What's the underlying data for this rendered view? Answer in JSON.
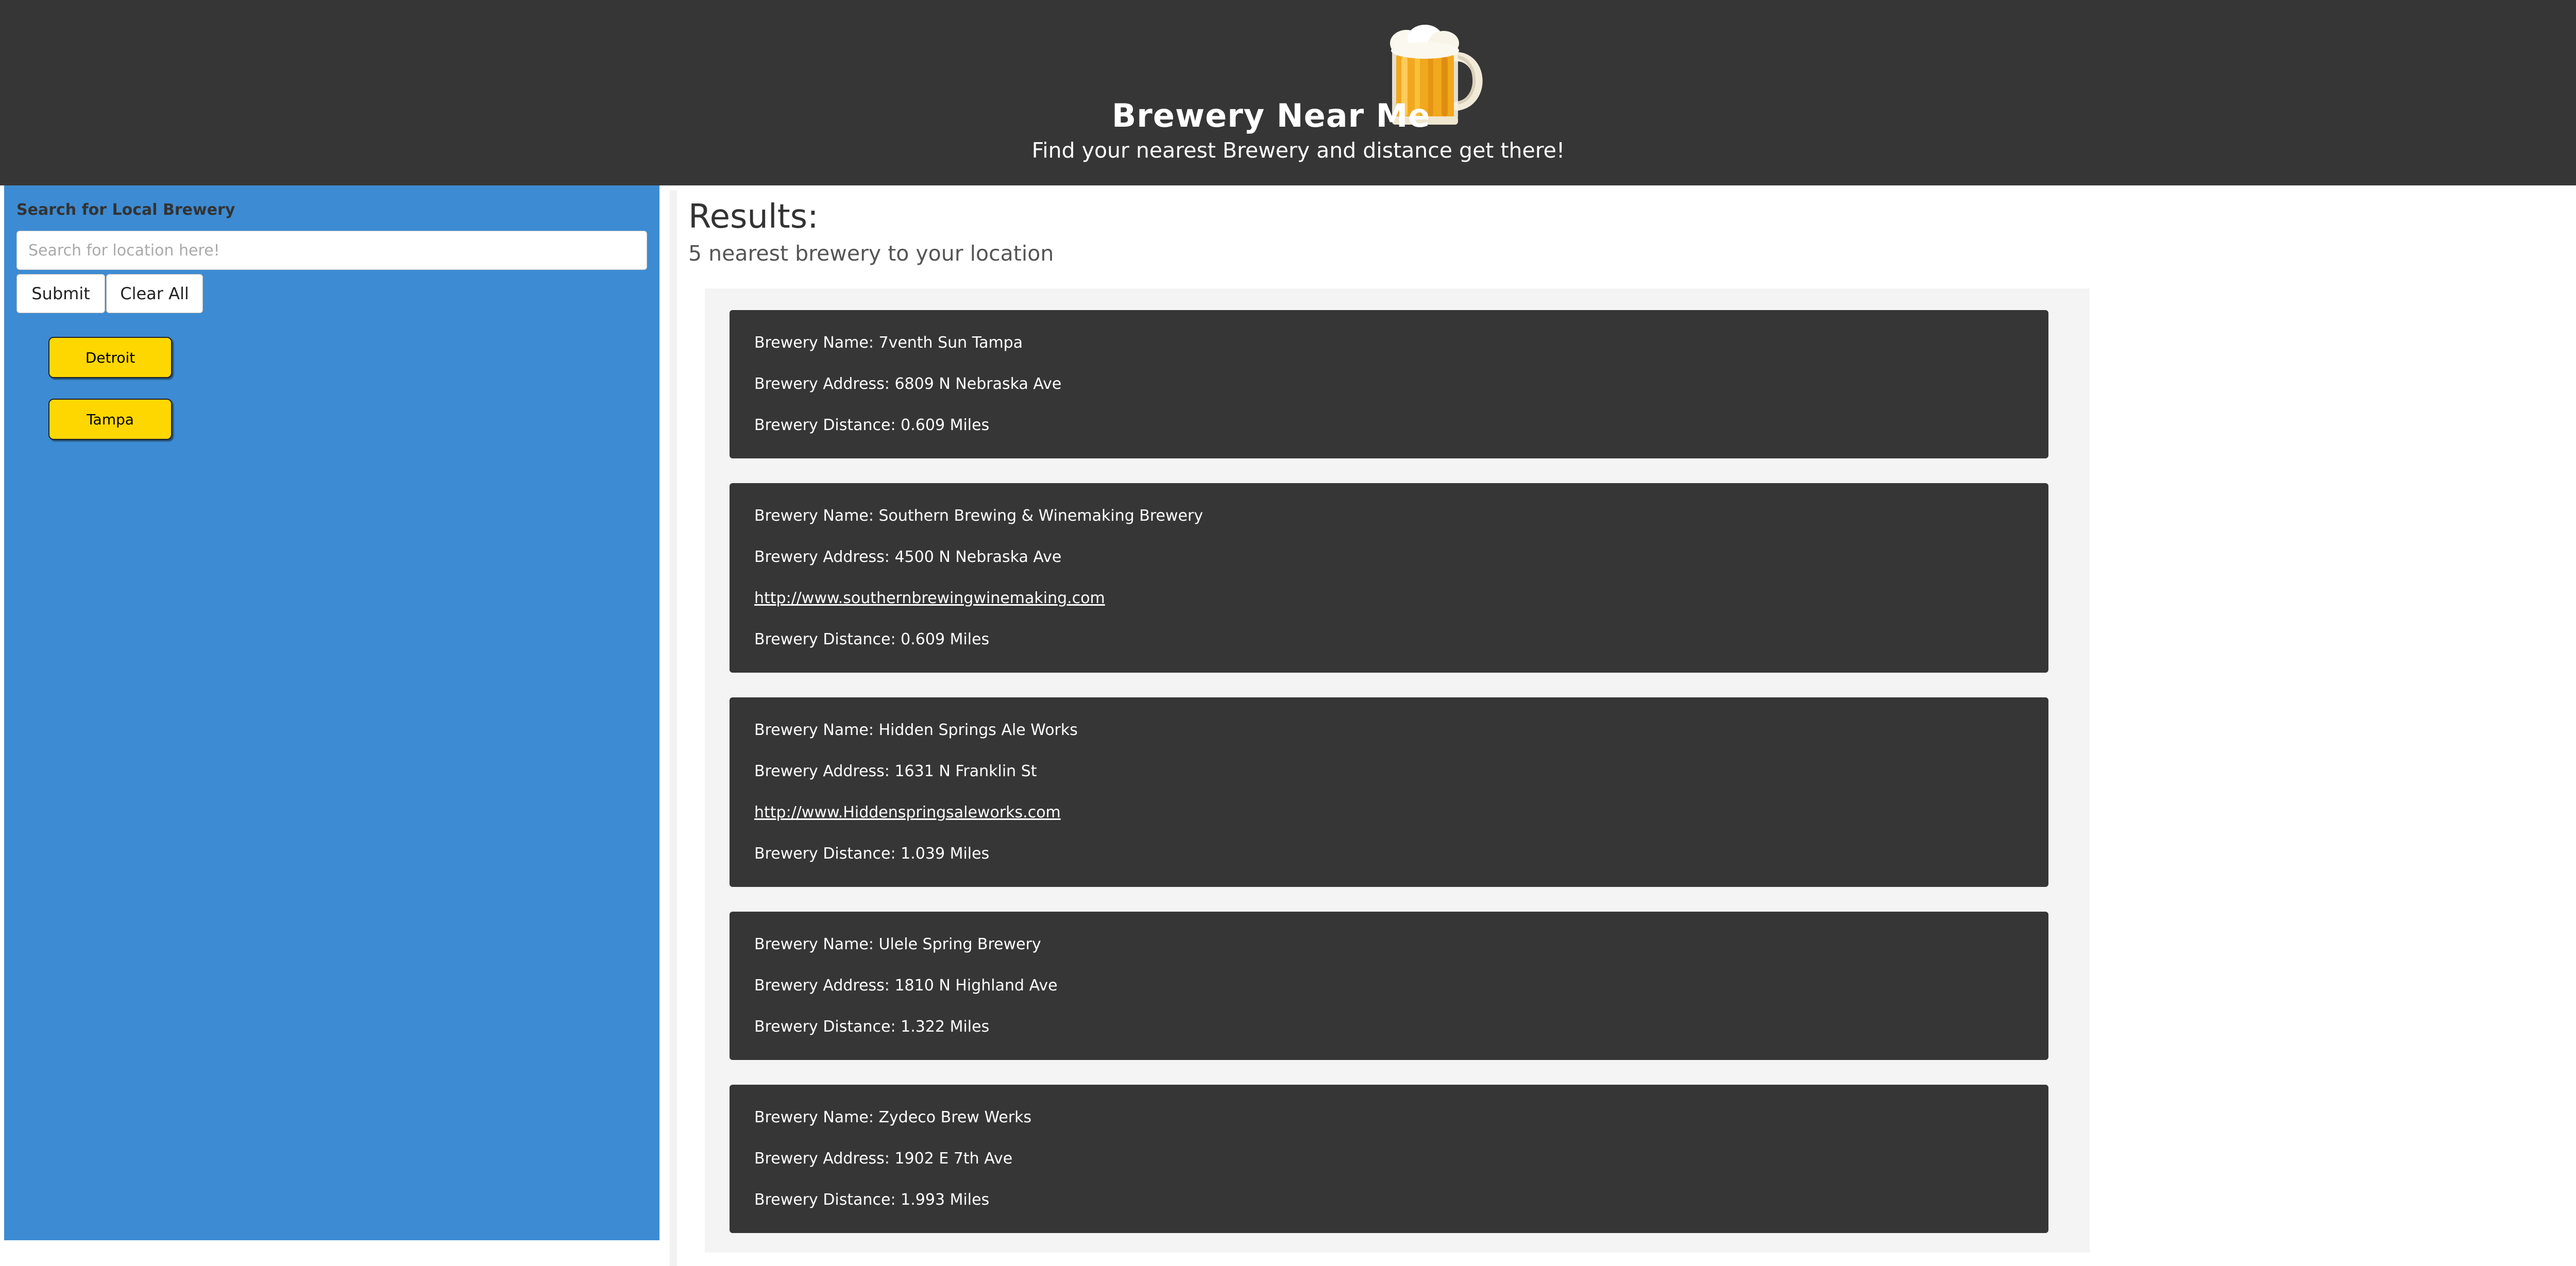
{
  "header": {
    "title": "Brewery Near Me",
    "subtitle": "Find your nearest Brewery and distance get there!",
    "logo_icon": "beer-mug-icon",
    "background": "#363636"
  },
  "sidebar": {
    "heading": "Search for Local Brewery",
    "search_placeholder": "Search for location here!",
    "search_value": "",
    "submit_label": "Submit",
    "clear_label": "Clear All",
    "history": [
      "Detroit",
      "Tampa"
    ],
    "background": "#3d8bd2",
    "history_button_color": "#ffd700"
  },
  "results": {
    "heading": "Results:",
    "subheading": "5 nearest brewery to your location",
    "breweries": [
      {
        "name": "Brewery Name: 7venth Sun Tampa",
        "address": "Brewery Address: 6809 N Nebraska Ave",
        "url": "",
        "distance": "Brewery Distance: 0.609 Miles"
      },
      {
        "name": "Brewery Name: Southern Brewing & Winemaking Brewery",
        "address": "Brewery Address: 4500 N Nebraska Ave",
        "url": "http://www.southernbrewingwinemaking.com",
        "distance": "Brewery Distance: 0.609 Miles"
      },
      {
        "name": "Brewery Name: Hidden Springs Ale Works",
        "address": "Brewery Address: 1631 N Franklin St",
        "url": "http://www.Hiddenspringsaleworks.com",
        "distance": "Brewery Distance: 1.039 Miles"
      },
      {
        "name": "Brewery Name: Ulele Spring Brewery",
        "address": "Brewery Address: 1810 N Highland Ave",
        "url": "",
        "distance": "Brewery Distance: 1.322 Miles"
      },
      {
        "name": "Brewery Name: Zydeco Brew Werks",
        "address": "Brewery Address: 1902 E 7th Ave",
        "url": "",
        "distance": "Brewery Distance: 1.993 Miles"
      }
    ],
    "card_background": "#363636",
    "panel_background": "#f4f4f4"
  }
}
